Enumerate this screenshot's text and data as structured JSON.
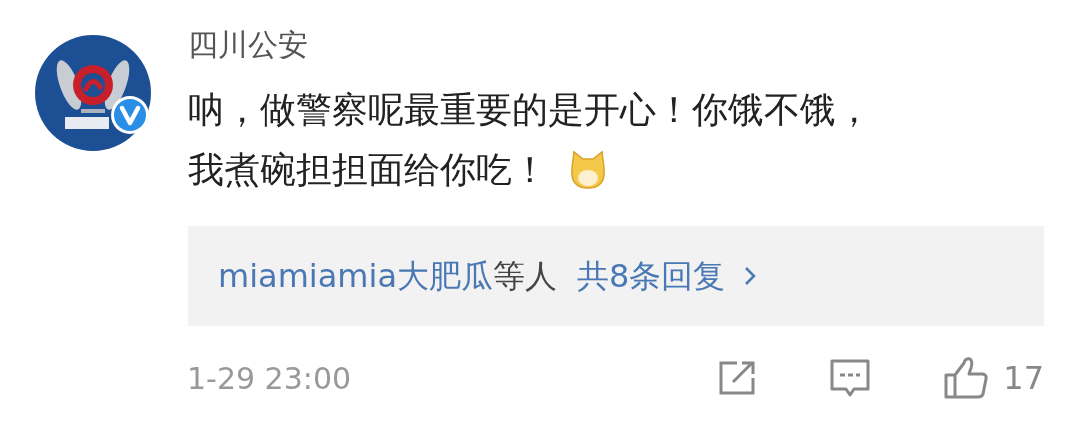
{
  "comment": {
    "author": "四川公安",
    "verified": true,
    "text_lines": [
      "呐，做警察呢最重要的是开心！你饿不饿，",
      "我煮碗担担面给你吃！"
    ],
    "replies": {
      "users": "miamiamia大肥瓜",
      "suffix": "等人",
      "count": "共8条回复"
    },
    "time": "1-29 23:00",
    "likes": "17"
  }
}
